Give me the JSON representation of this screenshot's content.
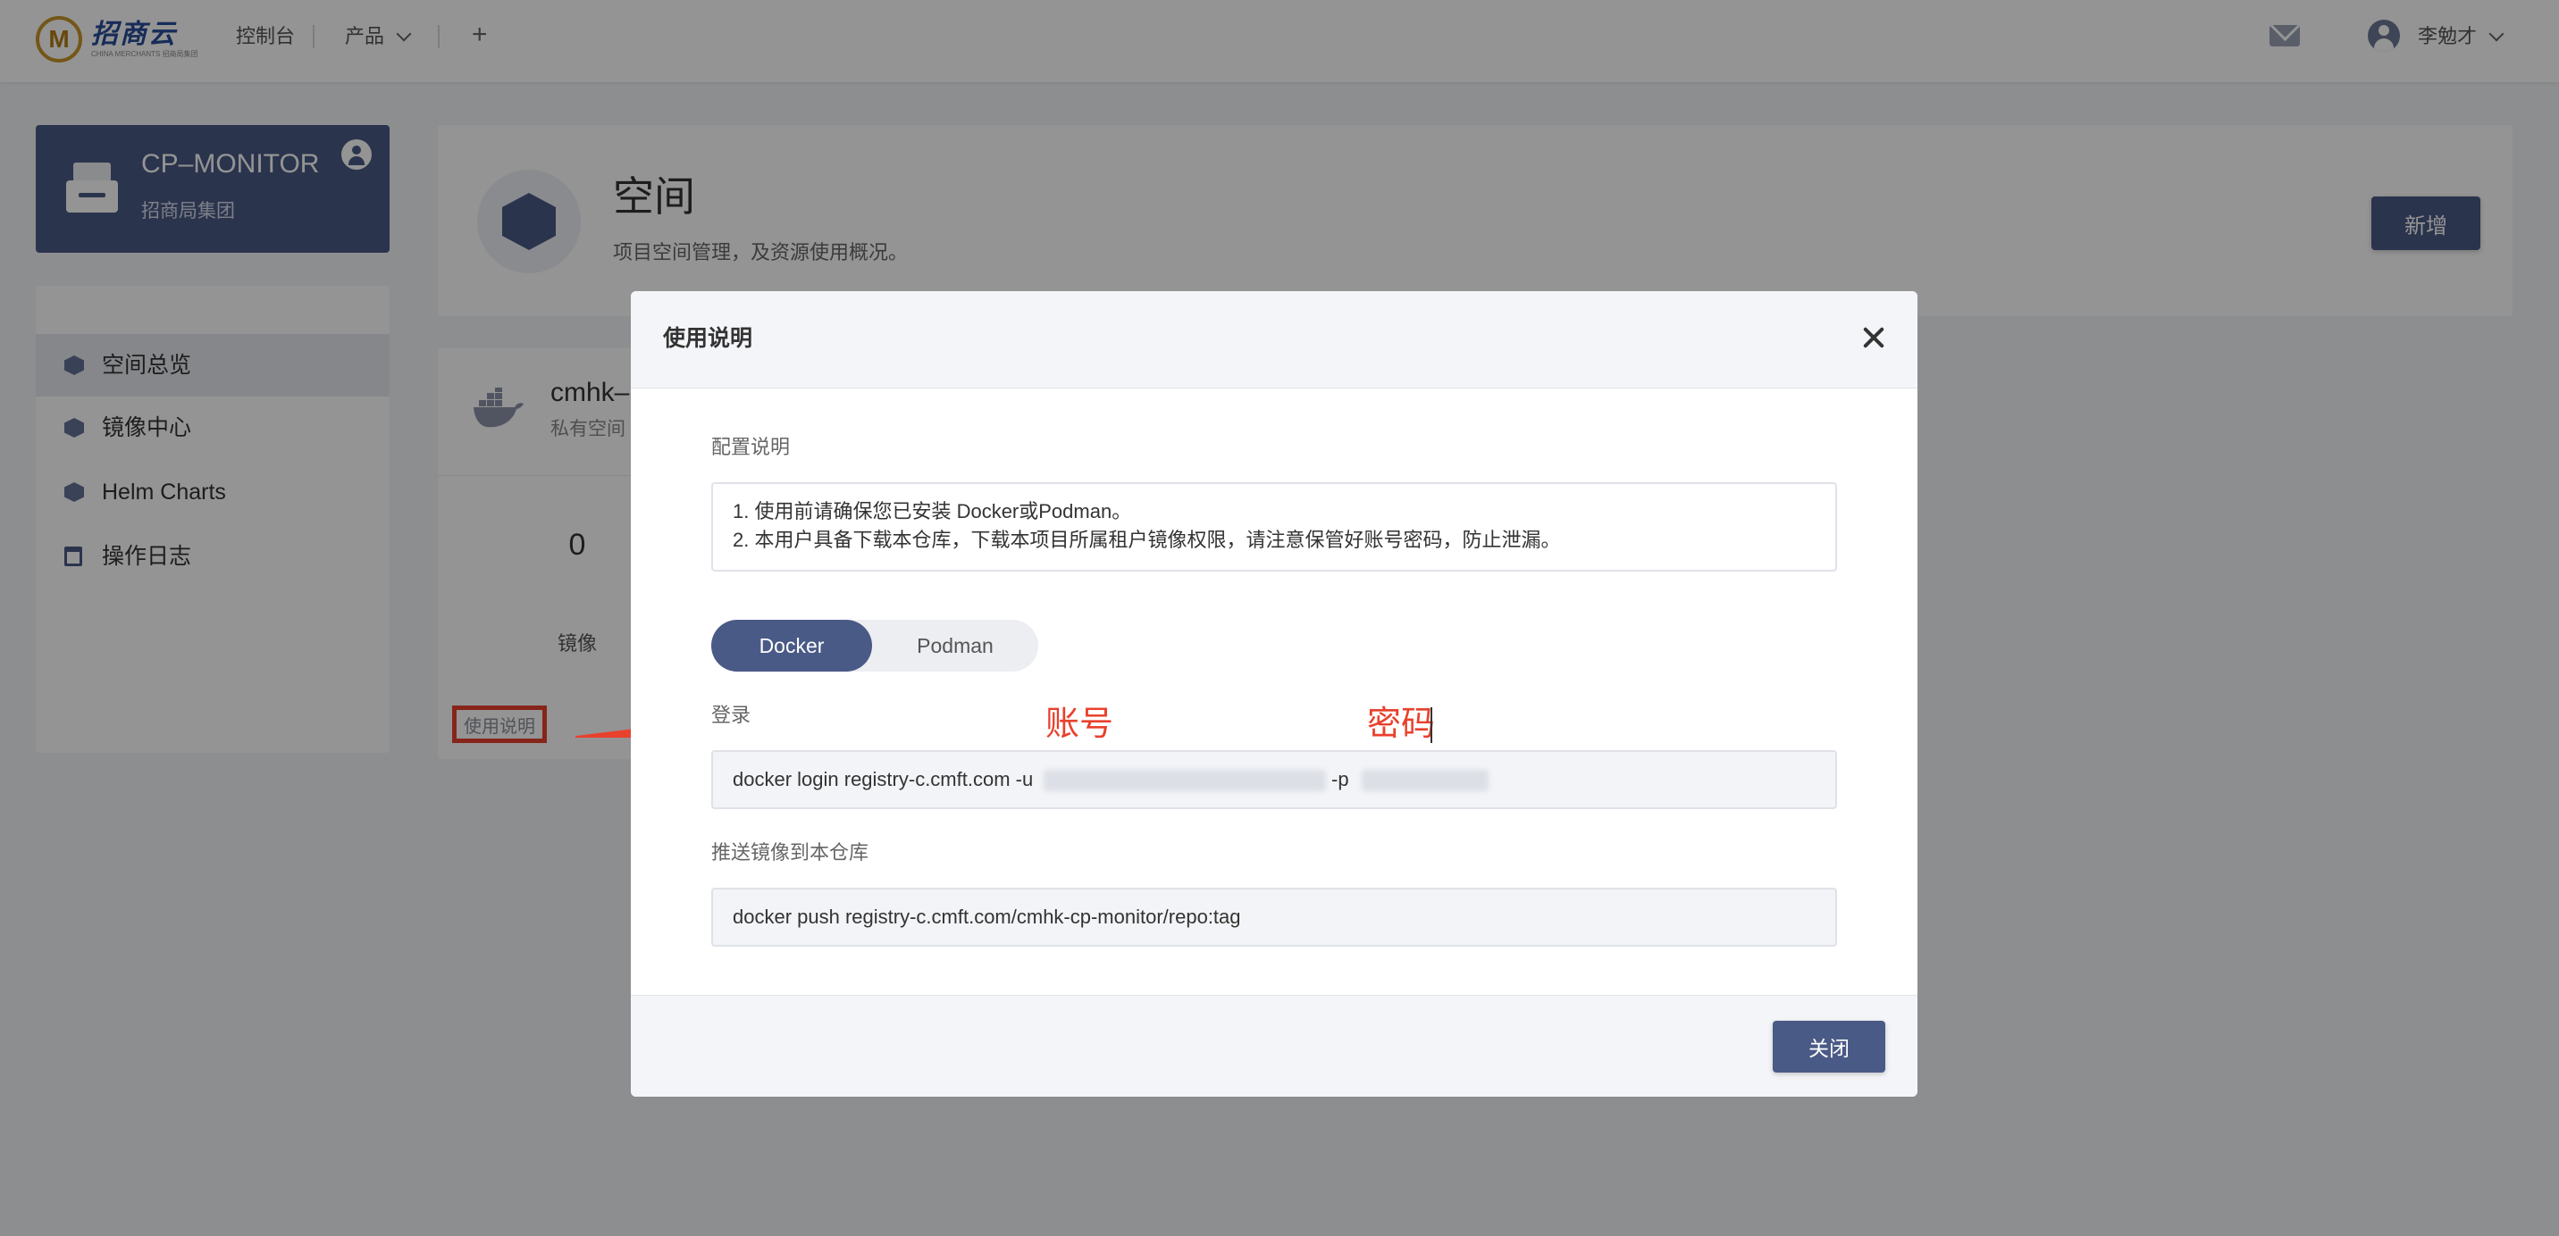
{
  "topbar": {
    "logo_text": "招商云",
    "logo_sub": "CHINA MERCHANTS 招商局集团",
    "nav_console": "控制台",
    "nav_products": "产品",
    "nav_add": "+",
    "username": "李勉才"
  },
  "project": {
    "name": "CP–MONITOR",
    "org": "招商局集团"
  },
  "sidebar": {
    "items": [
      {
        "label": "空间总览",
        "icon": "cube-icon",
        "active": true
      },
      {
        "label": "镜像中心",
        "icon": "cube-icon",
        "active": false
      },
      {
        "label": "Helm Charts",
        "icon": "cube-icon",
        "active": false
      },
      {
        "label": "操作日志",
        "icon": "calendar-icon",
        "active": false
      }
    ]
  },
  "page": {
    "title": "空间",
    "subtitle": "项目空间管理，及资源使用概况。",
    "new_button": "新增"
  },
  "repo": {
    "name": "cmhk–",
    "type": "私有空间",
    "stat_value": "0",
    "stat_label": "镜像",
    "usage_link": "使用说明"
  },
  "modal": {
    "title": "使用说明",
    "config_label": "配置说明",
    "notes": [
      "1. 使用前请确保您已安装 Docker或Podman。",
      "2. 本用户具备下载本仓库，下载本项目所属租户镜像权限，请注意保管好账号密码，防止泄漏。"
    ],
    "tabs": {
      "docker": "Docker",
      "podman": "Podman",
      "active": "docker"
    },
    "login_label": "登录",
    "annotation_account": "账号",
    "annotation_password": "密码",
    "login_cmd_prefix": "docker login registry-c.cmft.com -u",
    "login_cmd_p": "-p",
    "push_label": "推送镜像到本仓库",
    "push_cmd": "docker push registry-c.cmft.com/cmhk-cp-monitor/repo:tag",
    "close_button": "关闭"
  },
  "colors": {
    "primary": "#4a5a86",
    "annotation_red": "#e8412d",
    "logo_gold": "#c8962a",
    "logo_blue": "#2a4c9a"
  }
}
